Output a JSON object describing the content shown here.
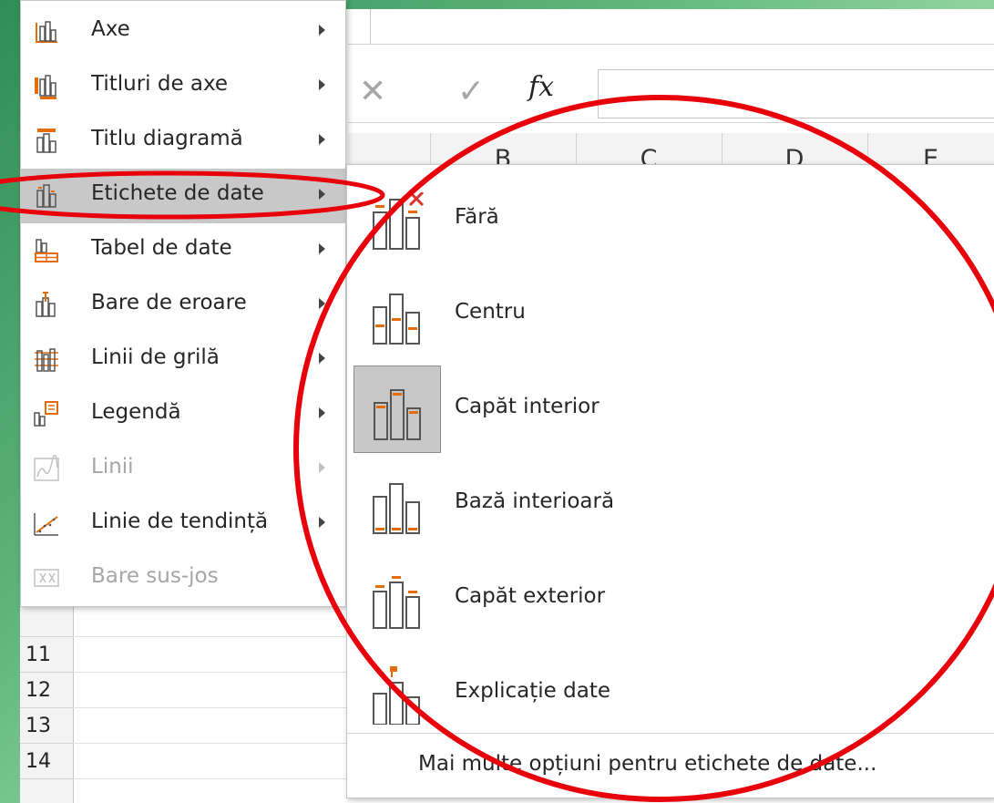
{
  "formula": {
    "fx_label": "fx"
  },
  "columns": [
    "B",
    "C",
    "D",
    "E"
  ],
  "rows": [
    "11",
    "12",
    "13",
    "14"
  ],
  "chart_elements_menu": {
    "items": [
      {
        "label": "Axe",
        "icon": "axes-icon",
        "has_submenu": true,
        "enabled": true,
        "selected": false
      },
      {
        "label": "Titluri de axe",
        "icon": "axis-titles-icon",
        "has_submenu": true,
        "enabled": true,
        "selected": false
      },
      {
        "label": "Titlu diagramă",
        "icon": "chart-title-icon",
        "has_submenu": true,
        "enabled": true,
        "selected": false
      },
      {
        "label": "Etichete de date",
        "icon": "data-labels-icon",
        "has_submenu": true,
        "enabled": true,
        "selected": true
      },
      {
        "label": "Tabel de date",
        "icon": "data-table-icon",
        "has_submenu": true,
        "enabled": true,
        "selected": false
      },
      {
        "label": "Bare de eroare",
        "icon": "error-bars-icon",
        "has_submenu": true,
        "enabled": true,
        "selected": false
      },
      {
        "label": "Linii de grilă",
        "icon": "gridlines-icon",
        "has_submenu": true,
        "enabled": true,
        "selected": false
      },
      {
        "label": "Legendă",
        "icon": "legend-icon",
        "has_submenu": true,
        "enabled": true,
        "selected": false
      },
      {
        "label": "Linii",
        "icon": "lines-icon",
        "has_submenu": true,
        "enabled": false,
        "selected": false
      },
      {
        "label": "Linie de tendință",
        "icon": "trendline-icon",
        "has_submenu": true,
        "enabled": true,
        "selected": false
      },
      {
        "label": "Bare sus-jos",
        "icon": "up-down-bars-icon",
        "has_submenu": false,
        "enabled": false,
        "selected": false
      }
    ]
  },
  "data_labels_submenu": {
    "items": [
      {
        "label": "Fără",
        "icon": "no-labels-icon",
        "selected": false
      },
      {
        "label": "Centru",
        "icon": "center-labels-icon",
        "selected": false
      },
      {
        "label": "Capăt interior",
        "icon": "inside-end-labels-icon",
        "selected": true
      },
      {
        "label": "Bază interioară",
        "icon": "inside-base-labels-icon",
        "selected": false
      },
      {
        "label": "Capăt exterior",
        "icon": "outside-end-labels-icon",
        "selected": false
      },
      {
        "label": "Explicație date",
        "icon": "data-callout-icon",
        "selected": false
      }
    ],
    "more_options_label": "Mai multe opțiuni pentru etichete de date..."
  },
  "colors": {
    "accent_orange": "#e46c0a",
    "annotation_red": "#e8000b",
    "selected_bg": "#c8c8c8"
  }
}
